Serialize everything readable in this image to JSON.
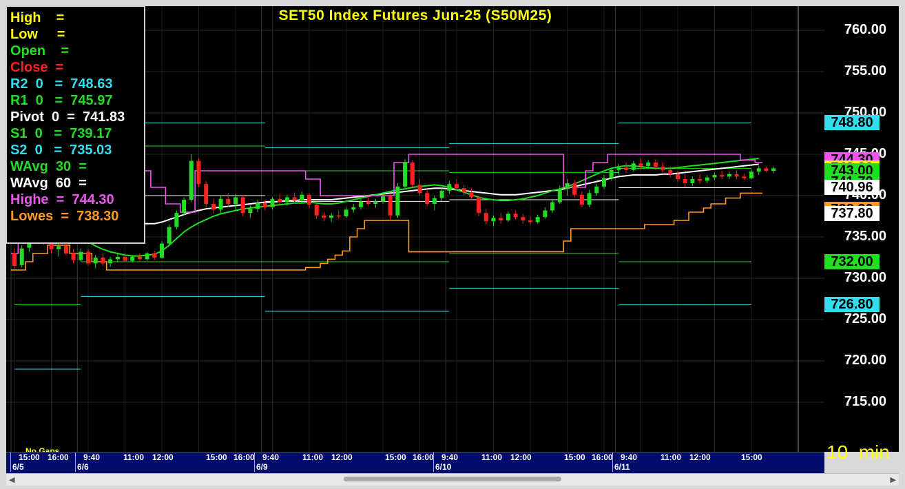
{
  "window": {
    "title": "SET50  Index  Futures  Jun-25  (S50M25)",
    "interval": "10  min",
    "no_gaps": "No  Gaps"
  },
  "legend": [
    {
      "label": "High    =",
      "color": "#ffff00"
    },
    {
      "label": "Low     =",
      "color": "#ffff00"
    },
    {
      "label": "Open    =",
      "color": "#22dd22"
    },
    {
      "label": "Close  =",
      "color": "#ff2222"
    },
    {
      "label": "R2  0   =  748.63",
      "color": "#33ddee"
    },
    {
      "label": "R1  0   =  745.97",
      "color": "#22dd22"
    },
    {
      "label": "Pivot  0  =  741.83",
      "color": "#ffffff"
    },
    {
      "label": "S1  0   =  739.17",
      "color": "#22dd22"
    },
    {
      "label": "S2  0   =  735.03",
      "color": "#33ddee"
    },
    {
      "label": "WAvg  30  =",
      "color": "#22dd22"
    },
    {
      "label": "WAvg  60  =",
      "color": "#ffffff"
    },
    {
      "label": "Highe  =  744.30",
      "color": "#ee55ee"
    },
    {
      "label": "Lowes  =  738.30",
      "color": "#ff9922"
    }
  ],
  "yaxis": {
    "ticks": [
      "760.00",
      "755.00",
      "750.00",
      "745.00",
      "740.00",
      "735.00",
      "730.00",
      "725.00",
      "720.00",
      "715.00"
    ],
    "badges": [
      {
        "value": "748.80",
        "bg": "#33ddee",
        "fg": "#000000"
      },
      {
        "value": "744.30",
        "bg": "#ee55ee",
        "fg": "#000000"
      },
      {
        "value": "743.30",
        "bg": "#ffff00",
        "fg": "#000000"
      },
      {
        "value": "743.00",
        "bg": "#22dd22",
        "fg": "#000000"
      },
      {
        "value": "741.70",
        "bg": "#22dd22",
        "fg": "#000000"
      },
      {
        "value": "740.96",
        "bg": "#ffffff",
        "fg": "#000000"
      },
      {
        "value": "738.30",
        "bg": "#ff9922",
        "fg": "#000000"
      },
      {
        "value": "737.80",
        "bg": "#ffffff",
        "fg": "#000000"
      },
      {
        "value": "732.00",
        "bg": "#22dd22",
        "fg": "#000000"
      },
      {
        "value": "726.80",
        "bg": "#33ddee",
        "fg": "#000000"
      }
    ]
  },
  "xaxis": {
    "times": [
      "15:00",
      "16:00",
      "9:40",
      "11:00",
      "12:00",
      "15:00",
      "16:00",
      "9:40",
      "11:00",
      "12:00",
      "15:00",
      "16:00",
      "9:40",
      "11:00",
      "12:00",
      "15:00",
      "16:00",
      "9:40",
      "11:00",
      "12:00",
      "15:00"
    ],
    "dates": [
      "6/5",
      "6/6",
      "6/9",
      "6/10",
      "6/11"
    ]
  },
  "colors": {
    "up": "#22dd22",
    "down": "#ff2222",
    "highest": "#ee55ee",
    "lowest": "#ff9922",
    "wavg30": "#22dd22",
    "wavg60": "#ffffff",
    "pivot_r2": "#33ddee",
    "pivot_r1": "#22dd22",
    "pivot_p": "#ffffff",
    "pivot_s1": "#22dd22",
    "pivot_s2": "#33ddee"
  },
  "chart_data": {
    "type": "candlestick",
    "title": "SET50  Index  Futures  Jun-25  (S50M25)",
    "ylim": [
      710,
      762
    ],
    "grid": true,
    "legend_placement": "top-left",
    "sessions": [
      "6/5",
      "6/6",
      "6/9",
      "6/10",
      "6/11"
    ],
    "pivots_by_session": [
      {
        "session": "6/5",
        "R2": 748.8,
        "R1": 745.0,
        "P": 740.0,
        "S1": 726.8,
        "S2": 719.0
      },
      {
        "session": "6/6",
        "R2": 748.8,
        "R1": 746.0,
        "P": 740.0,
        "S1": 732.0,
        "S2": 727.8
      },
      {
        "session": "6/9",
        "R2": 745.8,
        "R1": 743.0,
        "P": 739.3,
        "S1": 732.0,
        "S2": 726.0
      },
      {
        "session": "6/10",
        "R2": 746.3,
        "R1": 742.8,
        "P": 739.5,
        "S1": 733.0,
        "S2": 728.8
      },
      {
        "session": "6/11",
        "R2": 748.8,
        "R1": 743.3,
        "P": 740.96,
        "S1": 732.0,
        "S2": 726.8
      }
    ],
    "highest_30": [
      733,
      735,
      736,
      738,
      739,
      742,
      744,
      744,
      744,
      744,
      744,
      744,
      744,
      744,
      744,
      744,
      744,
      743,
      743,
      741,
      741,
      739,
      739,
      738,
      738,
      743,
      743,
      743,
      743,
      743,
      743,
      743,
      743,
      743,
      743,
      743,
      743,
      743,
      743,
      743,
      742,
      742,
      740,
      740,
      740,
      740,
      740,
      740,
      740,
      740,
      740,
      740,
      744,
      744,
      745,
      745,
      745,
      745,
      745,
      745,
      745,
      745,
      745,
      745,
      745,
      745,
      745,
      745,
      745,
      745,
      745,
      745,
      745,
      745,
      745,
      741,
      741,
      741,
      743,
      744,
      744,
      745,
      745,
      745,
      745,
      745,
      745,
      745,
      745,
      745,
      745,
      745,
      745,
      745,
      745,
      745,
      745,
      745,
      745,
      744.3,
      744.3,
      744
    ],
    "lowest_30": [
      731,
      731,
      732,
      733,
      733,
      734,
      734,
      734,
      733,
      733,
      733,
      732,
      732,
      731,
      731,
      731,
      731,
      731,
      731,
      731,
      731,
      731,
      731,
      731,
      731,
      731,
      731,
      731,
      731,
      731,
      731,
      731,
      731,
      731,
      731,
      731,
      731,
      731,
      731,
      731,
      731.3,
      731.3,
      731.8,
      732.3,
      732.8,
      733.3,
      735.0,
      736.0,
      737.0,
      737.0,
      737.0,
      737.0,
      737.0,
      737.0,
      733.2,
      733.2,
      733.2,
      733.2,
      733.2,
      733.2,
      733.2,
      733.2,
      733.2,
      733.2,
      733.2,
      733.2,
      733.2,
      733.2,
      733.2,
      733.2,
      733.2,
      733.2,
      733.2,
      733.2,
      733.2,
      734.5,
      736.0,
      736.0,
      736.0,
      736.0,
      736.0,
      736.0,
      736.0,
      736.0,
      736.0,
      736.0,
      736.5,
      736.5,
      736.5,
      736.5,
      737.0,
      737.0,
      738.0,
      738.0,
      738.5,
      739.0,
      739.0,
      739.7,
      739.7,
      740.3,
      740.3,
      740.3
    ],
    "wavg_30": [
      738.0,
      737.8,
      737.5,
      737.2,
      736.9,
      736.6,
      736.2,
      735.8,
      735.3,
      734.9,
      734.4,
      733.9,
      733.5,
      733.2,
      733.0,
      732.8,
      732.7,
      732.7,
      732.8,
      732.9,
      733.3,
      734.0,
      734.8,
      735.6,
      736.2,
      736.7,
      737.1,
      737.5,
      737.8,
      738.0,
      738.2,
      738.4,
      738.5,
      738.6,
      738.7,
      738.8,
      738.9,
      739.0,
      739.1,
      739.1,
      739.2,
      739.1,
      739.0,
      739.0,
      739.1,
      739.3,
      739.5,
      739.7,
      739.9,
      740.1,
      740.3,
      740.5,
      740.7,
      740.8,
      741.0,
      741.1,
      741.2,
      741.3,
      741.2,
      741.0,
      740.7,
      740.4,
      740.1,
      739.8,
      739.6,
      739.5,
      739.4,
      739.4,
      739.5,
      739.6,
      739.8,
      740.0,
      740.3,
      740.6,
      740.8,
      741.1,
      741.4,
      741.8,
      742.2,
      742.6,
      743.0,
      743.3,
      743.5,
      743.6,
      743.6,
      743.5,
      743.4,
      743.3,
      743.3,
      743.3,
      743.4,
      743.5,
      743.6,
      743.7,
      743.8,
      743.9,
      744.0,
      744.1,
      744.2,
      744.3,
      744.4,
      744.5
    ],
    "wavg_60": [
      739.5,
      739.4,
      739.3,
      739.2,
      739.0,
      738.8,
      738.6,
      738.4,
      738.2,
      738.0,
      737.8,
      737.6,
      737.4,
      737.2,
      737.0,
      736.8,
      736.7,
      736.6,
      736.6,
      736.6,
      736.8,
      737.1,
      737.4,
      737.7,
      738.0,
      738.2,
      738.4,
      738.5,
      738.6,
      738.7,
      738.8,
      738.9,
      739.0,
      739.1,
      739.2,
      739.2,
      739.3,
      739.4,
      739.4,
      739.5,
      739.5,
      739.5,
      739.5,
      739.5,
      739.6,
      739.7,
      739.8,
      739.9,
      740.0,
      740.1,
      740.2,
      740.3,
      740.4,
      740.5,
      740.6,
      740.7,
      740.8,
      740.9,
      740.9,
      740.8,
      740.7,
      740.6,
      740.5,
      740.4,
      740.3,
      740.2,
      740.1,
      740.1,
      740.1,
      740.2,
      740.3,
      740.4,
      740.5,
      740.6,
      740.7,
      740.9,
      741.1,
      741.3,
      741.5,
      741.7,
      741.9,
      742.1,
      742.3,
      742.4,
      742.5,
      742.5,
      742.5,
      742.5,
      742.6,
      742.6,
      742.7,
      742.8,
      742.9,
      743.0,
      743.1,
      743.2,
      743.3,
      743.4,
      743.5,
      743.6,
      743.7,
      743.8
    ],
    "candles": [
      {
        "o": 733.0,
        "h": 733.6,
        "l": 731.2,
        "c": 731.5
      },
      {
        "o": 731.6,
        "h": 734.0,
        "l": 731.3,
        "c": 733.6
      },
      {
        "o": 733.7,
        "h": 735.5,
        "l": 733.2,
        "c": 735.0
      },
      {
        "o": 735.1,
        "h": 736.3,
        "l": 734.5,
        "c": 735.8
      },
      {
        "o": 735.8,
        "h": 736.2,
        "l": 734.0,
        "c": 734.4
      },
      {
        "o": 734.4,
        "h": 735.0,
        "l": 733.0,
        "c": 733.5
      },
      {
        "o": 733.5,
        "h": 734.3,
        "l": 732.6,
        "c": 733.9
      },
      {
        "o": 733.9,
        "h": 734.4,
        "l": 732.8,
        "c": 733.0
      },
      {
        "o": 733.0,
        "h": 733.5,
        "l": 731.8,
        "c": 732.2
      },
      {
        "o": 732.2,
        "h": 733.6,
        "l": 732.0,
        "c": 733.2
      },
      {
        "o": 733.2,
        "h": 733.5,
        "l": 731.5,
        "c": 731.8
      },
      {
        "o": 731.8,
        "h": 732.8,
        "l": 731.2,
        "c": 732.5
      },
      {
        "o": 732.5,
        "h": 733.0,
        "l": 731.5,
        "c": 731.8
      },
      {
        "o": 731.8,
        "h": 732.6,
        "l": 731.4,
        "c": 732.3
      },
      {
        "o": 732.3,
        "h": 732.9,
        "l": 731.9,
        "c": 732.6
      },
      {
        "o": 732.6,
        "h": 733.0,
        "l": 732.0,
        "c": 732.1
      },
      {
        "o": 732.1,
        "h": 732.8,
        "l": 731.9,
        "c": 732.6
      },
      {
        "o": 732.6,
        "h": 733.0,
        "l": 732.1,
        "c": 732.3
      },
      {
        "o": 732.3,
        "h": 733.2,
        "l": 732.1,
        "c": 733.0
      },
      {
        "o": 733.0,
        "h": 733.3,
        "l": 732.2,
        "c": 732.5
      },
      {
        "o": 732.5,
        "h": 734.5,
        "l": 732.4,
        "c": 734.2
      },
      {
        "o": 734.2,
        "h": 736.5,
        "l": 734.0,
        "c": 736.2
      },
      {
        "o": 736.2,
        "h": 738.2,
        "l": 735.9,
        "c": 737.9
      },
      {
        "o": 737.9,
        "h": 739.8,
        "l": 737.6,
        "c": 739.5
      },
      {
        "o": 739.5,
        "h": 745.0,
        "l": 739.2,
        "c": 744.2
      },
      {
        "o": 744.2,
        "h": 744.5,
        "l": 741.0,
        "c": 741.4
      },
      {
        "o": 741.4,
        "h": 741.8,
        "l": 738.5,
        "c": 739.0
      },
      {
        "o": 739.0,
        "h": 739.6,
        "l": 737.8,
        "c": 738.3
      },
      {
        "o": 738.3,
        "h": 740.0,
        "l": 737.9,
        "c": 739.6
      },
      {
        "o": 739.6,
        "h": 740.3,
        "l": 738.6,
        "c": 739.0
      },
      {
        "o": 739.0,
        "h": 740.2,
        "l": 738.2,
        "c": 739.8
      },
      {
        "o": 739.8,
        "h": 740.0,
        "l": 737.5,
        "c": 737.9
      },
      {
        "o": 737.9,
        "h": 738.8,
        "l": 737.3,
        "c": 738.4
      },
      {
        "o": 738.4,
        "h": 739.5,
        "l": 738.0,
        "c": 739.1
      },
      {
        "o": 739.1,
        "h": 739.5,
        "l": 738.2,
        "c": 738.6
      },
      {
        "o": 738.6,
        "h": 739.8,
        "l": 738.3,
        "c": 739.6
      },
      {
        "o": 739.6,
        "h": 740.2,
        "l": 738.9,
        "c": 739.2
      },
      {
        "o": 739.2,
        "h": 740.1,
        "l": 738.8,
        "c": 739.8
      },
      {
        "o": 739.8,
        "h": 740.4,
        "l": 739.0,
        "c": 739.4
      },
      {
        "o": 739.4,
        "h": 740.5,
        "l": 739.1,
        "c": 740.1
      },
      {
        "o": 740.1,
        "h": 740.3,
        "l": 738.5,
        "c": 738.9
      },
      {
        "o": 738.9,
        "h": 739.3,
        "l": 737.2,
        "c": 737.6
      },
      {
        "o": 737.6,
        "h": 738.0,
        "l": 736.9,
        "c": 737.3
      },
      {
        "o": 737.3,
        "h": 737.9,
        "l": 736.8,
        "c": 737.6
      },
      {
        "o": 737.6,
        "h": 738.2,
        "l": 737.2,
        "c": 737.5
      },
      {
        "o": 737.5,
        "h": 738.6,
        "l": 737.3,
        "c": 738.3
      },
      {
        "o": 738.3,
        "h": 739.0,
        "l": 737.9,
        "c": 738.6
      },
      {
        "o": 738.6,
        "h": 739.6,
        "l": 738.3,
        "c": 739.3
      },
      {
        "o": 739.3,
        "h": 740.0,
        "l": 738.8,
        "c": 739.0
      },
      {
        "o": 739.0,
        "h": 739.6,
        "l": 738.5,
        "c": 739.3
      },
      {
        "o": 739.3,
        "h": 740.2,
        "l": 739.0,
        "c": 739.9
      },
      {
        "o": 739.9,
        "h": 740.3,
        "l": 737.0,
        "c": 737.6
      },
      {
        "o": 737.6,
        "h": 741.5,
        "l": 737.3,
        "c": 741.1
      },
      {
        "o": 741.1,
        "h": 744.4,
        "l": 740.7,
        "c": 744.0
      },
      {
        "o": 744.0,
        "h": 744.3,
        "l": 741.0,
        "c": 741.3
      },
      {
        "o": 741.3,
        "h": 742.0,
        "l": 740.0,
        "c": 740.3
      },
      {
        "o": 740.3,
        "h": 740.8,
        "l": 738.7,
        "c": 739.0
      },
      {
        "o": 739.0,
        "h": 740.0,
        "l": 738.2,
        "c": 739.7
      },
      {
        "o": 739.7,
        "h": 741.0,
        "l": 739.3,
        "c": 740.6
      },
      {
        "o": 740.6,
        "h": 741.8,
        "l": 740.2,
        "c": 741.4
      },
      {
        "o": 741.4,
        "h": 742.0,
        "l": 740.6,
        "c": 740.9
      },
      {
        "o": 740.9,
        "h": 741.3,
        "l": 740.0,
        "c": 740.4
      },
      {
        "o": 740.4,
        "h": 740.9,
        "l": 739.5,
        "c": 739.8
      },
      {
        "o": 739.8,
        "h": 740.0,
        "l": 737.5,
        "c": 737.9
      },
      {
        "o": 737.9,
        "h": 738.4,
        "l": 736.5,
        "c": 736.9
      },
      {
        "o": 736.9,
        "h": 737.6,
        "l": 736.3,
        "c": 737.3
      },
      {
        "o": 737.3,
        "h": 737.9,
        "l": 736.6,
        "c": 737.0
      },
      {
        "o": 737.0,
        "h": 738.1,
        "l": 736.8,
        "c": 737.8
      },
      {
        "o": 737.8,
        "h": 738.2,
        "l": 737.1,
        "c": 737.4
      },
      {
        "o": 737.4,
        "h": 737.8,
        "l": 736.6,
        "c": 737.0
      },
      {
        "o": 737.0,
        "h": 737.5,
        "l": 736.5,
        "c": 736.8
      },
      {
        "o": 736.8,
        "h": 737.7,
        "l": 736.6,
        "c": 737.4
      },
      {
        "o": 737.4,
        "h": 738.6,
        "l": 737.2,
        "c": 738.2
      },
      {
        "o": 738.2,
        "h": 739.6,
        "l": 737.9,
        "c": 739.2
      },
      {
        "o": 739.2,
        "h": 741.2,
        "l": 739.0,
        "c": 740.8
      },
      {
        "o": 740.8,
        "h": 742.0,
        "l": 740.0,
        "c": 741.5
      },
      {
        "o": 741.5,
        "h": 741.9,
        "l": 739.8,
        "c": 740.1
      },
      {
        "o": 740.1,
        "h": 740.5,
        "l": 738.6,
        "c": 738.9
      },
      {
        "o": 738.9,
        "h": 740.7,
        "l": 738.6,
        "c": 740.3
      },
      {
        "o": 740.3,
        "h": 741.4,
        "l": 740.0,
        "c": 741.1
      },
      {
        "o": 741.1,
        "h": 742.5,
        "l": 740.8,
        "c": 742.1
      },
      {
        "o": 742.1,
        "h": 743.4,
        "l": 741.8,
        "c": 743.1
      },
      {
        "o": 743.1,
        "h": 743.8,
        "l": 742.5,
        "c": 743.4
      },
      {
        "o": 743.4,
        "h": 744.0,
        "l": 742.8,
        "c": 743.1
      },
      {
        "o": 743.1,
        "h": 744.2,
        "l": 742.9,
        "c": 743.9
      },
      {
        "o": 743.9,
        "h": 744.5,
        "l": 743.2,
        "c": 743.6
      },
      {
        "o": 743.6,
        "h": 744.3,
        "l": 743.3,
        "c": 744.0
      },
      {
        "o": 744.0,
        "h": 744.4,
        "l": 743.1,
        "c": 743.5
      },
      {
        "o": 743.5,
        "h": 744.0,
        "l": 742.8,
        "c": 743.1
      },
      {
        "o": 743.1,
        "h": 743.5,
        "l": 742.2,
        "c": 742.6
      },
      {
        "o": 742.6,
        "h": 743.0,
        "l": 741.6,
        "c": 742.0
      },
      {
        "o": 742.0,
        "h": 742.6,
        "l": 741.1,
        "c": 741.5
      },
      {
        "o": 741.5,
        "h": 742.3,
        "l": 741.2,
        "c": 742.0
      },
      {
        "o": 742.0,
        "h": 742.6,
        "l": 741.4,
        "c": 741.8
      },
      {
        "o": 741.8,
        "h": 742.5,
        "l": 741.5,
        "c": 742.2
      },
      {
        "o": 742.2,
        "h": 742.8,
        "l": 741.9,
        "c": 742.5
      },
      {
        "o": 742.5,
        "h": 743.0,
        "l": 742.0,
        "c": 742.3
      },
      {
        "o": 742.3,
        "h": 742.9,
        "l": 742.0,
        "c": 742.6
      },
      {
        "o": 742.6,
        "h": 743.1,
        "l": 742.0,
        "c": 742.3
      },
      {
        "o": 742.3,
        "h": 742.7,
        "l": 741.9,
        "c": 742.1
      },
      {
        "o": 742.1,
        "h": 743.2,
        "l": 742.0,
        "c": 742.9
      },
      {
        "o": 742.9,
        "h": 743.6,
        "l": 742.5,
        "c": 743.3
      },
      {
        "o": 743.3,
        "h": 743.5,
        "l": 742.8,
        "c": 743.0
      },
      {
        "o": 743.0,
        "h": 743.5,
        "l": 742.7,
        "c": 743.3
      }
    ]
  }
}
